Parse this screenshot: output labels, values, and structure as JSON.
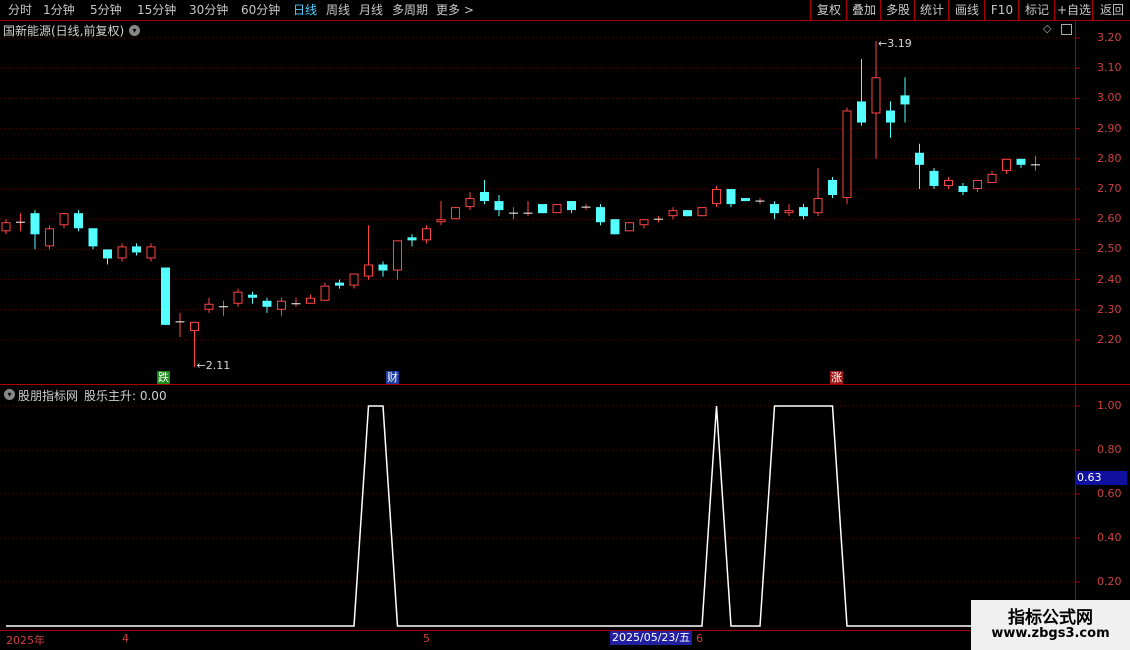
{
  "toolbar": {
    "periods": [
      "分时",
      "1分钟",
      "5分钟",
      "15分钟",
      "30分钟",
      "60分钟",
      "日线",
      "周线",
      "月线",
      "多周期",
      "更多 >"
    ],
    "active_period": "日线",
    "right_buttons": [
      "复权",
      "叠加",
      "多股",
      "统计",
      "画线",
      "F10",
      "标记",
      "+自选",
      "返回"
    ]
  },
  "main_panel": {
    "title": "国新能源(日线,前复权)",
    "title_icon": "chevron-down-icon",
    "top_right_icons": [
      "diamond-icon",
      "window-icon"
    ],
    "y_ticks": [
      "3.20",
      "3.10",
      "3.00",
      "2.90",
      "2.80",
      "2.70",
      "2.60",
      "2.50",
      "2.40",
      "2.30",
      "2.20"
    ],
    "high_label": "3.19",
    "low_label": "2.11",
    "event_markers": [
      {
        "text": "跌",
        "color": "#1a8a1a"
      },
      {
        "text": "财",
        "color": "#1a3aa0"
      },
      {
        "text": "涨",
        "color": "#a01a1a"
      }
    ]
  },
  "indicator_panel": {
    "title": "股朋指标网",
    "series_label": "股乐主升: 0.00",
    "current_value": "0.63",
    "y_ticks": [
      "1.00",
      "0.80",
      "0.60",
      "0.40",
      "0.20"
    ]
  },
  "x_axis": {
    "labels": [
      "2025年",
      "4",
      "5",
      "6"
    ],
    "cursor_date": "2025/05/23/五"
  },
  "watermark": {
    "line1": "指标公式网",
    "line2": "www.zbgs3.com"
  },
  "colors": {
    "up": "#ff4444",
    "down": "#54ffff",
    "border": "#aa0000",
    "grid": "#5a0000",
    "line": "#ffffff"
  },
  "chart_data": [
    {
      "type": "candlestick",
      "title": "国新能源(日线,前复权)",
      "ylim": [
        2.13,
        3.25
      ],
      "candles": [
        [
          2.56,
          2.59,
          2.55,
          2.6
        ],
        [
          2.59,
          2.59,
          2.56,
          2.62
        ],
        [
          2.62,
          2.55,
          2.5,
          2.63
        ],
        [
          2.51,
          2.57,
          2.5,
          2.58
        ],
        [
          2.58,
          2.62,
          2.57,
          2.62
        ],
        [
          2.62,
          2.57,
          2.56,
          2.63
        ],
        [
          2.57,
          2.51,
          2.5,
          2.57
        ],
        [
          2.5,
          2.47,
          2.45,
          2.5
        ],
        [
          2.47,
          2.51,
          2.46,
          2.52
        ],
        [
          2.51,
          2.49,
          2.48,
          2.52
        ],
        [
          2.47,
          2.51,
          2.46,
          2.52
        ],
        [
          2.44,
          2.25,
          2.25,
          2.44
        ],
        [
          2.26,
          2.26,
          2.21,
          2.29
        ],
        [
          2.23,
          2.26,
          2.11,
          2.26
        ],
        [
          2.3,
          2.32,
          2.29,
          2.34
        ],
        [
          2.31,
          2.31,
          2.28,
          2.33
        ],
        [
          2.32,
          2.36,
          2.31,
          2.37
        ],
        [
          2.35,
          2.34,
          2.32,
          2.36
        ],
        [
          2.33,
          2.31,
          2.29,
          2.34
        ],
        [
          2.3,
          2.33,
          2.28,
          2.34
        ],
        [
          2.32,
          2.32,
          2.31,
          2.34
        ],
        [
          2.32,
          2.34,
          2.32,
          2.35
        ],
        [
          2.33,
          2.38,
          2.33,
          2.39
        ],
        [
          2.39,
          2.38,
          2.37,
          2.4
        ],
        [
          2.38,
          2.42,
          2.37,
          2.42
        ],
        [
          2.41,
          2.45,
          2.4,
          2.58
        ],
        [
          2.45,
          2.43,
          2.41,
          2.46
        ],
        [
          2.43,
          2.53,
          2.4,
          2.53
        ],
        [
          2.54,
          2.53,
          2.51,
          2.55
        ],
        [
          2.53,
          2.57,
          2.52,
          2.58
        ],
        [
          2.59,
          2.6,
          2.58,
          2.66
        ],
        [
          2.6,
          2.64,
          2.6,
          2.64
        ],
        [
          2.64,
          2.67,
          2.63,
          2.69
        ],
        [
          2.69,
          2.66,
          2.65,
          2.73
        ],
        [
          2.66,
          2.63,
          2.61,
          2.68
        ],
        [
          2.62,
          2.62,
          2.6,
          2.64
        ],
        [
          2.62,
          2.62,
          2.61,
          2.66
        ],
        [
          2.65,
          2.62,
          2.62,
          2.65
        ],
        [
          2.62,
          2.65,
          2.62,
          2.65
        ],
        [
          2.66,
          2.63,
          2.62,
          2.66
        ],
        [
          2.64,
          2.64,
          2.63,
          2.65
        ],
        [
          2.64,
          2.59,
          2.58,
          2.65
        ],
        [
          2.6,
          2.55,
          2.55,
          2.6
        ],
        [
          2.56,
          2.59,
          2.56,
          2.59
        ],
        [
          2.58,
          2.6,
          2.57,
          2.6
        ],
        [
          2.6,
          2.6,
          2.59,
          2.61
        ],
        [
          2.61,
          2.63,
          2.6,
          2.64
        ],
        [
          2.63,
          2.61,
          2.61,
          2.63
        ],
        [
          2.61,
          2.64,
          2.61,
          2.64
        ],
        [
          2.65,
          2.7,
          2.64,
          2.71
        ],
        [
          2.7,
          2.65,
          2.64,
          2.7
        ],
        [
          2.67,
          2.66,
          2.66,
          2.67
        ],
        [
          2.66,
          2.66,
          2.65,
          2.67
        ],
        [
          2.65,
          2.62,
          2.6,
          2.66
        ],
        [
          2.62,
          2.63,
          2.61,
          2.65
        ],
        [
          2.64,
          2.61,
          2.6,
          2.65
        ],
        [
          2.62,
          2.67,
          2.61,
          2.77
        ],
        [
          2.73,
          2.68,
          2.67,
          2.74
        ],
        [
          2.67,
          2.96,
          2.65,
          2.97
        ],
        [
          2.99,
          2.92,
          2.91,
          3.13
        ],
        [
          2.95,
          3.07,
          2.8,
          3.19
        ],
        [
          2.96,
          2.92,
          2.87,
          2.99
        ],
        [
          3.01,
          2.98,
          2.92,
          3.07
        ],
        [
          2.82,
          2.78,
          2.7,
          2.85
        ],
        [
          2.76,
          2.71,
          2.7,
          2.77
        ],
        [
          2.71,
          2.73,
          2.7,
          2.74
        ],
        [
          2.71,
          2.69,
          2.68,
          2.72
        ],
        [
          2.7,
          2.73,
          2.69,
          2.73
        ],
        [
          2.72,
          2.75,
          2.72,
          2.76
        ],
        [
          2.76,
          2.8,
          2.75,
          2.8
        ],
        [
          2.8,
          2.78,
          2.77,
          2.8
        ],
        [
          2.78,
          2.78,
          2.76,
          2.81
        ]
      ]
    },
    {
      "type": "line",
      "title": "股朋指标网",
      "series": [
        {
          "name": "股乐主升",
          "values": [
            0,
            0,
            0,
            0,
            0,
            0,
            0,
            0,
            0,
            0,
            0,
            0,
            0,
            0,
            0,
            0,
            0,
            0,
            0,
            0,
            0,
            0,
            0,
            0,
            0,
            1,
            1,
            0,
            0,
            0,
            0,
            0,
            0,
            0,
            0,
            0,
            0,
            0,
            0,
            0,
            0,
            0,
            0,
            0,
            0,
            0,
            0,
            0,
            0,
            1,
            0,
            0,
            0,
            1,
            1,
            1,
            1,
            1,
            0,
            0,
            0,
            0,
            0,
            0,
            0,
            0,
            0,
            0,
            0,
            0,
            0,
            0
          ]
        }
      ],
      "ylim": [
        0,
        1.05
      ]
    }
  ]
}
